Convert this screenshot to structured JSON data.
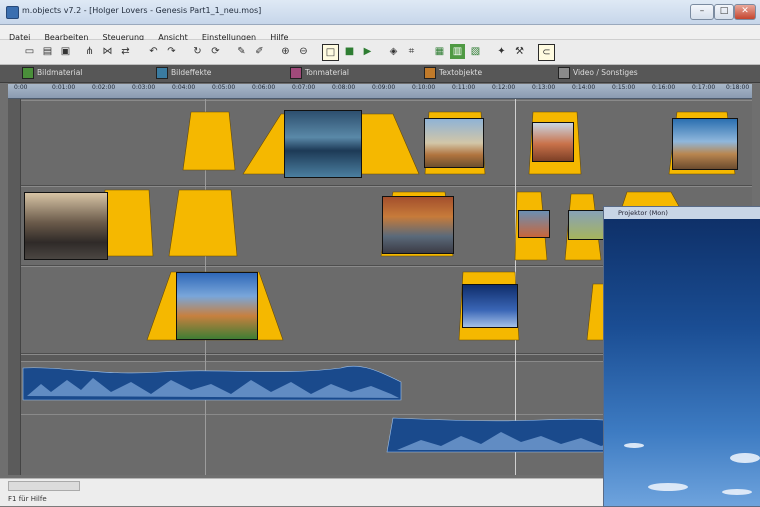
{
  "window": {
    "title": "m.objects v7.2 - [Holger Lovers - Genesis Part1_1_neu.mos]",
    "buttons": [
      "–",
      "□",
      "✕"
    ]
  },
  "menu": [
    "Datei",
    "Bearbeiten",
    "Steuerung",
    "Ansicht",
    "Einstellungen",
    "Hilfe"
  ],
  "toolbar": {
    "icons": [
      "new-icon",
      "open-icon",
      "save-icon",
      "split-icon",
      "join-icon",
      "move-icon",
      "undo-icon",
      "redo-icon",
      "refresh-icon",
      "cycle-icon",
      "pipette-icon",
      "brush-icon",
      "zoom-in-icon",
      "zoom-out-icon",
      "select-frame-icon",
      "stop-icon",
      "play-icon",
      "speaker-icon",
      "marker-icon",
      "image-icon",
      "table-icon",
      "clip-icon",
      "pin-icon",
      "tool-icon",
      "magnet-icon"
    ]
  },
  "tabs": [
    {
      "label": "Bildmaterial",
      "color": "#4a8f3a"
    },
    {
      "label": "Bildeffekte",
      "color": "#3a7ba0"
    },
    {
      "label": "Tonmaterial",
      "color": "#a04a7a"
    },
    {
      "label": "Textobjekte",
      "color": "#c07a2a"
    },
    {
      "label": "Video / Sonstiges",
      "color": "#8a8a8a"
    }
  ],
  "ruler": {
    "ticks": [
      "0:00",
      "0:01:00",
      "0:02:00",
      "0:03:00",
      "0:04:00",
      "0:05:00",
      "0:06:00",
      "0:07:00",
      "0:08:00",
      "0:09:00",
      "0:10:00",
      "0:11:00",
      "0:12:00",
      "0:13:00",
      "0:14:00",
      "0:15:00",
      "0:16:00",
      "0:17:00",
      "0:18:00"
    ]
  },
  "preview": {
    "title": "Projektor (Mon)"
  },
  "status": {
    "text": "F1 für Hilfe"
  },
  "colors": {
    "yellow": "#f5b800",
    "track": "#6b6b6b",
    "audio": "#1a4a8c"
  }
}
